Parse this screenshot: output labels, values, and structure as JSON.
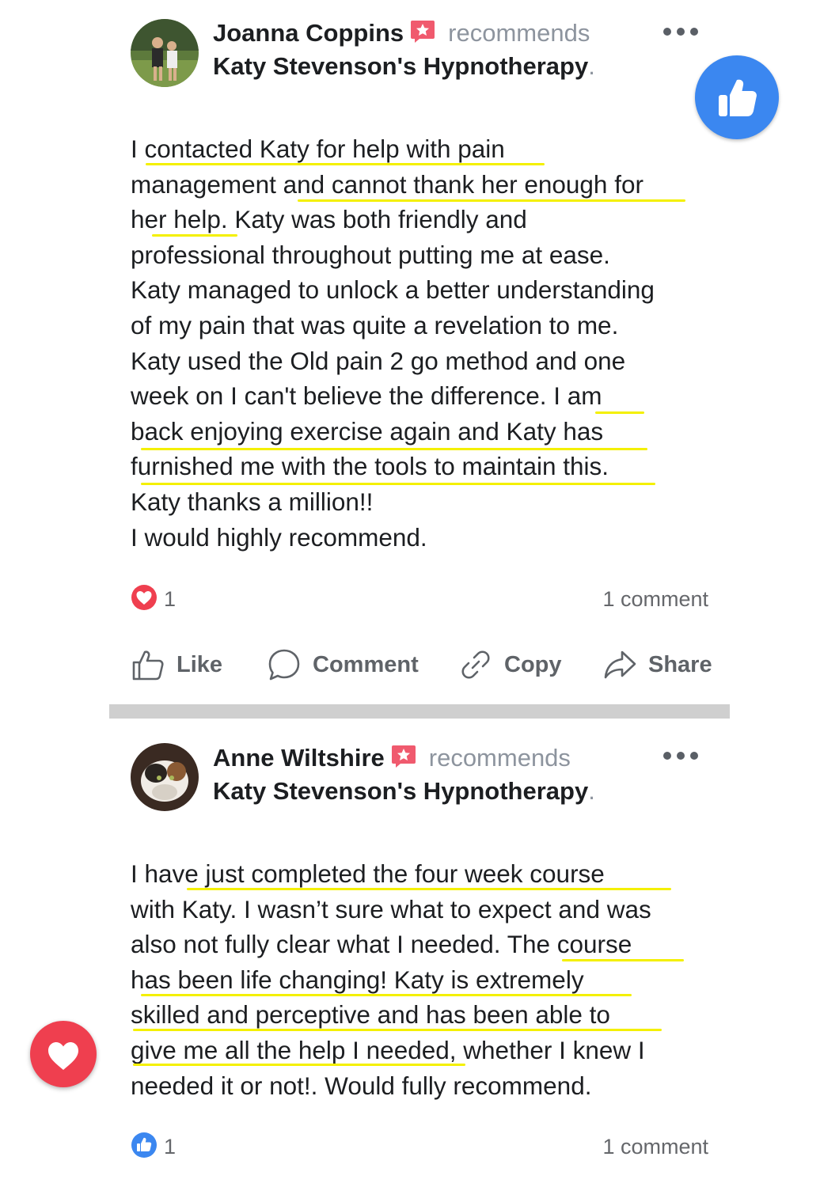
{
  "posts": [
    {
      "author": "Joanna Coppins",
      "recommends": "recommends",
      "page": "Katy Stevenson's Hypnotherapy",
      "body_lines": [
        "I contacted Katy for help with pain",
        "management and cannot thank her enough for",
        "her help. Katy was both friendly and",
        "professional throughout putting me at ease.",
        "Katy managed to unlock a better understanding",
        "of my pain that was quite a revelation to me.",
        "Katy used the Old pain 2 go method and one",
        "week on I can't believe the difference. I am",
        "back enjoying exercise again and Katy has",
        "furnished me with the tools to maintain this.",
        "Katy thanks a million!!",
        "I would highly recommend."
      ],
      "reaction_count": "1",
      "comments": "1 comment",
      "actions": {
        "like": "Like",
        "comment": "Comment",
        "copy": "Copy",
        "share": "Share"
      }
    },
    {
      "author": "Anne Wiltshire",
      "recommends": "recommends",
      "page": "Katy Stevenson's Hypnotherapy",
      "body_lines": [
        "I have just completed the four week course",
        "with Katy. I wasn’t sure what to expect and was",
        "also not fully clear what I needed. The course",
        "has been life changing! Katy is extremely",
        "skilled and perceptive and has been able to",
        "give me all the help I needed, whether I knew I",
        "needed it or not!. Would fully recommend."
      ],
      "reaction_count": "1",
      "comments": "1 comment"
    }
  ],
  "colors": {
    "highlight": "#f4f000",
    "like_blue": "#3b87f0",
    "love_red": "#ef3f4f",
    "recommend_badge": "#f05a6e",
    "muted_text": "#8d949e"
  },
  "icons": [
    "recommend-star-icon",
    "more-options-icon",
    "like-thumb-icon",
    "comment-bubble-icon",
    "copy-link-icon",
    "share-arrow-icon",
    "love-heart-icon"
  ]
}
